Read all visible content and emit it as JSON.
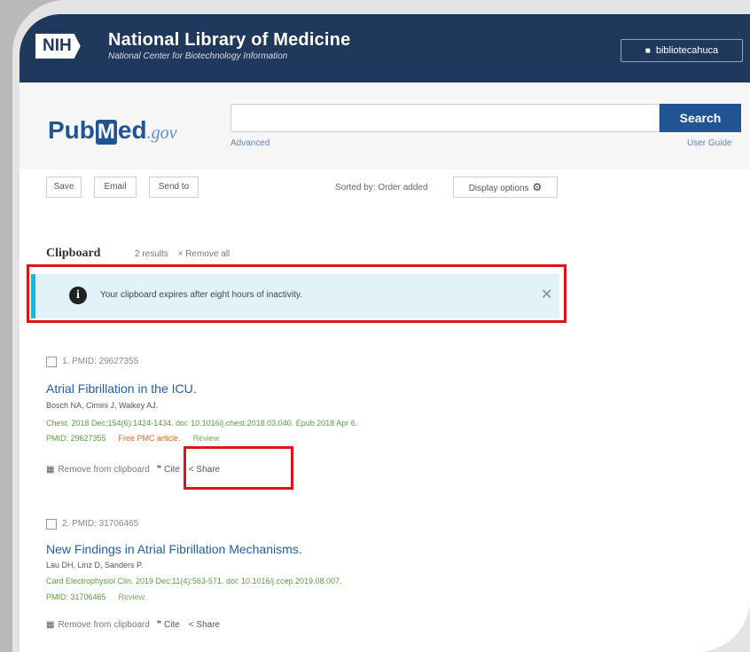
{
  "header": {
    "org_abbr": "NIH",
    "title": "National Library of Medicine",
    "subtitle": "National Center for Biotechnology Information",
    "user": "bibliotecahuca"
  },
  "search": {
    "logo_pub": "Pub",
    "logo_m": "M",
    "logo_ed": "ed",
    "logo_gov": ".gov",
    "value": "",
    "button": "Search",
    "advanced": "Advanced",
    "guide": "User Guide"
  },
  "toolbar": {
    "save": "Save",
    "email": "Email",
    "send_to": "Send to",
    "sorted": "Sorted by: Order added",
    "display": "Display options"
  },
  "clipboard": {
    "title": "Clipboard",
    "count": "2 results",
    "remove_all": "× Remove all",
    "alert": "Your clipboard expires after eight hours of inactivity."
  },
  "results": [
    {
      "num": "1. PMID: 29627355",
      "title": "Atrial Fibrillation in the ICU.",
      "authors": "Bosch NA, Cimini J, Walkey AJ.",
      "citation": "Chest. 2018 Dec;154(6):1424-1434. doi: 10.1016/j.chest.2018.03.040. Epub 2018 Apr 6.",
      "pmid": "PMID: 29627355",
      "free": "Free PMC article.",
      "type": "Review.",
      "remove": "Remove from clipboard",
      "cite": "Cite",
      "share": "Share"
    },
    {
      "num": "2. PMID: 31706465",
      "title": "New Findings in Atrial Fibrillation Mechanisms.",
      "authors": "Lau DH, Linz D, Sanders P.",
      "citation": "Card Electrophysiol Clin. 2019 Dec;11(4):563-571. doi: 10.1016/j.ccep.2019.08.007.",
      "pmid": "PMID: 31706465",
      "type": "Review.",
      "remove": "Remove from clipboard",
      "cite": "Cite",
      "share": "Share"
    }
  ],
  "colors": {
    "header_bg": "#20385c",
    "brand_blue": "#205493",
    "alert_bg": "#e1f3f8",
    "alert_bar": "#02bfe7",
    "highlight": "#e2121b"
  }
}
